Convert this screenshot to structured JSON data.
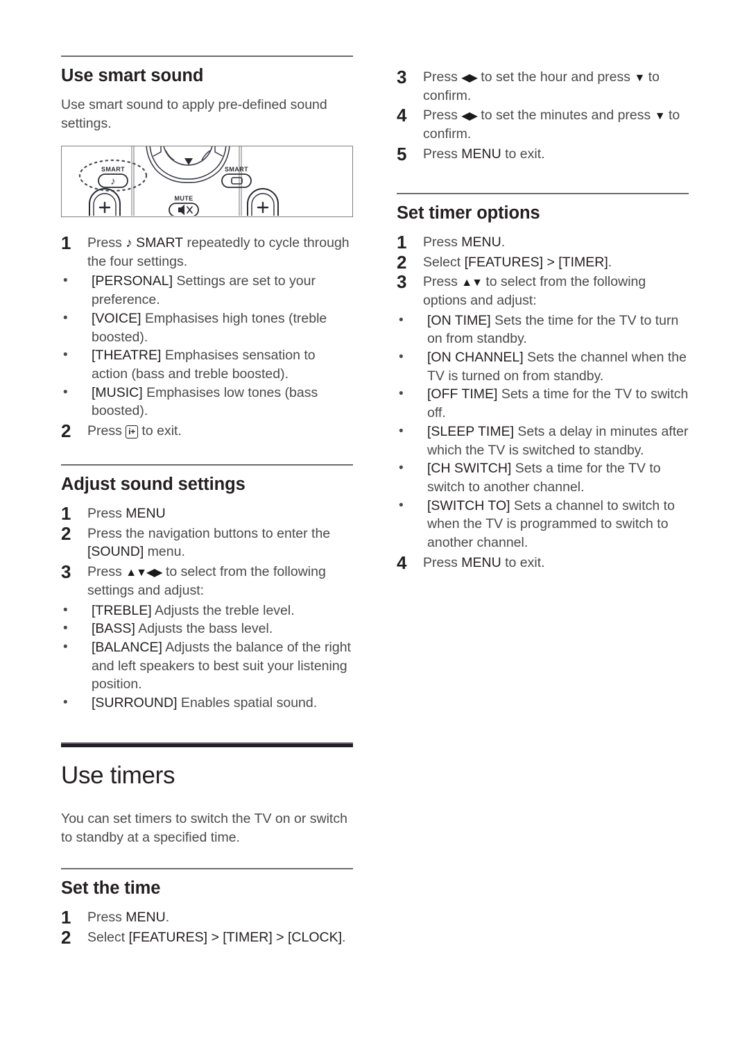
{
  "document": {
    "page_background": "#ffffff",
    "rule_color": "#6b6b6b",
    "major_rule_color": "#231f26",
    "major_rule_accent": "#6e5e78",
    "heading_color": "#231f20",
    "body_color": "#4a4a4a"
  },
  "left_column": {
    "smart_sound": {
      "heading": "Use smart sound",
      "intro": "Use smart sound to apply pre-defined sound settings.",
      "figure": {
        "alt": "Remote control close-up showing SMART sound and SMART picture buttons, navigation ring, MUTE and plus keys",
        "labels": {
          "smart_left": "SMART",
          "smart_left_small": "SMART",
          "smart_right": "SMART",
          "mute": "MUTE",
          "plus_left": "+",
          "plus_right": "+",
          "nav_down": "▼"
        }
      },
      "steps": [
        {
          "num": "1",
          "text_pre": "Press ",
          "glyph": "♪",
          "text_key": " SMART",
          "text_post": " repeatedly to cycle through the four settings."
        },
        {
          "num": "2",
          "text_pre": "Press ",
          "key_icon": "i+",
          "text_post": " to exit."
        }
      ],
      "bullets": [
        {
          "token": "[PERSONAL]",
          "text": " Settings are set to your preference."
        },
        {
          "token": "[VOICE]",
          "text": " Emphasises high tones (treble boosted)."
        },
        {
          "token": "[THEATRE]",
          "text": " Emphasises sensation to action (bass and treble boosted)."
        },
        {
          "token": "[MUSIC]",
          "text": " Emphasises low tones (bass boosted)."
        }
      ]
    },
    "adjust_sound": {
      "heading": "Adjust sound settings",
      "steps": [
        {
          "num": "1",
          "text_pre": "Press ",
          "text_key": "MENU",
          "text_post": ""
        },
        {
          "num": "2",
          "text_pre": "Press the navigation buttons to enter the ",
          "text_key": "[SOUND]",
          "text_post": " menu."
        },
        {
          "num": "3",
          "text_pre": "Press ",
          "arrows": "▲▼◀▶",
          "text_post": " to select from the following settings and adjust:"
        }
      ],
      "bullets": [
        {
          "token": "[TREBLE]",
          "text": " Adjusts the treble level."
        },
        {
          "token": "[BASS]",
          "text": " Adjusts the bass level."
        },
        {
          "token": "[BALANCE]",
          "text": " Adjusts the balance of the right and left speakers to best suit your listening position."
        },
        {
          "token": "[SURROUND]",
          "text": " Enables spatial sound."
        }
      ]
    },
    "use_timers": {
      "heading": "Use timers",
      "intro": "You can set timers to switch the TV on or switch to standby at a specified time."
    },
    "set_the_time": {
      "heading": "Set the time",
      "steps": [
        {
          "num": "1",
          "text_pre": "Press ",
          "text_key": "MENU",
          "text_post": "."
        },
        {
          "num": "2",
          "text_pre": "Select ",
          "text_key": "[FEATURES] > [TIMER] > [CLOCK]",
          "text_post": "."
        }
      ]
    }
  },
  "right_column": {
    "set_the_time_cont": {
      "steps": [
        {
          "num": "3",
          "text_pre": "Press ",
          "arrows": "◀▶",
          "text_mid": " to set the hour and press ",
          "arrows2": "▼",
          "text_post": " to confirm."
        },
        {
          "num": "4",
          "text_pre": "Press ",
          "arrows": "◀▶",
          "text_mid": " to set the minutes and press ",
          "arrows2": "▼",
          "text_post": " to confirm."
        },
        {
          "num": "5",
          "text_pre": "Press ",
          "text_key": "MENU",
          "text_post": " to exit."
        }
      ]
    },
    "set_timer_options": {
      "heading": "Set timer options",
      "steps": [
        {
          "num": "1",
          "text_pre": "Press ",
          "text_key": "MENU",
          "text_post": "."
        },
        {
          "num": "2",
          "text_pre": "Select ",
          "text_key": "[FEATURES] > [TIMER]",
          "text_post": "."
        },
        {
          "num": "3",
          "text_pre": "Press ",
          "arrows": "▲▼",
          "text_post": " to select from the following options and adjust:"
        },
        {
          "num": "4",
          "text_pre": "Press ",
          "text_key": "MENU",
          "text_post": " to exit."
        }
      ],
      "bullets": [
        {
          "token": "[ON TIME]",
          "text": " Sets the time for the TV to turn on from standby."
        },
        {
          "token": "[ON CHANNEL]",
          "text": " Sets the channel when the TV is turned on from standby."
        },
        {
          "token": "[OFF TIME]",
          "text": " Sets a time for the TV to switch off."
        },
        {
          "token": "[SLEEP TIME]",
          "text": " Sets a delay in minutes after which the TV is switched to standby."
        },
        {
          "token": "[CH SWITCH]",
          "text": " Sets a time for the TV to switch to another channel."
        },
        {
          "token": "[SWITCH TO]",
          "text": " Sets a channel to switch to when the TV is programmed to switch to another channel."
        }
      ]
    }
  }
}
